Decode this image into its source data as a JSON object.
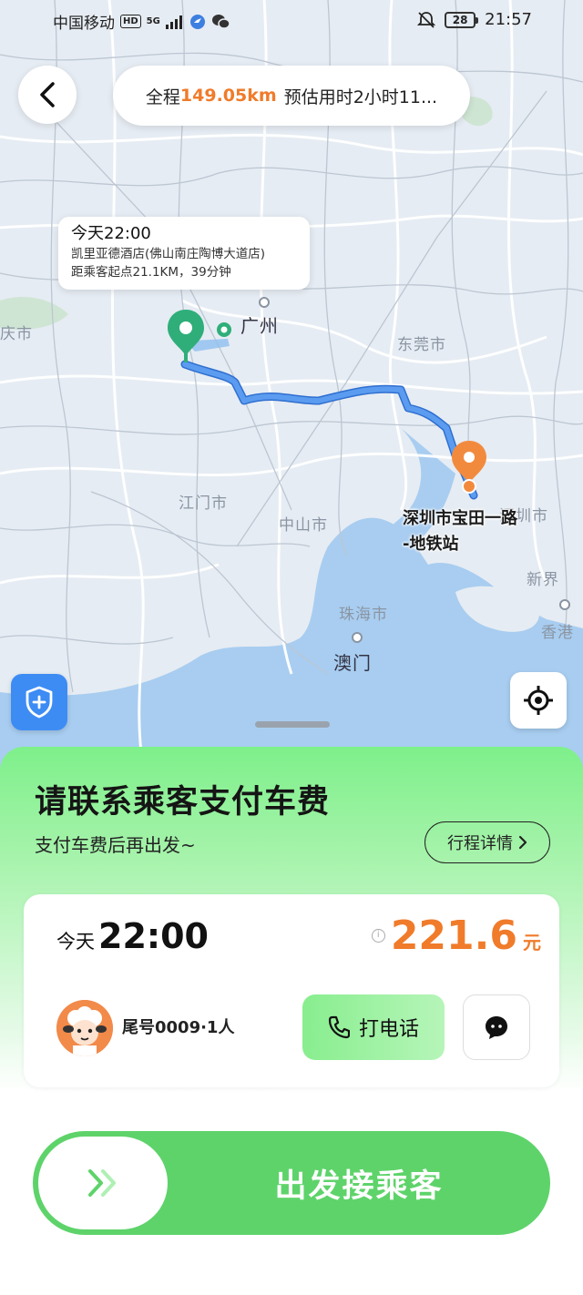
{
  "status_bar": {
    "carrier": "中国移动",
    "hd_badge": "HD",
    "network": "5G",
    "battery": "28",
    "time": "21:57"
  },
  "route": {
    "prefix": "全程",
    "distance": "149.05km",
    "estimate": "预估用时2小时11..."
  },
  "pickup": {
    "time": "今天22:00",
    "place": "凯里亚德酒店(佛山南庄陶博大道店)",
    "distance_info": "距乘客起点21.1KM，39分钟"
  },
  "destination": {
    "line1": "深圳市宝田一路",
    "line2": "-地铁站"
  },
  "map_labels": {
    "guangzhou": "广州",
    "dongguan": "东莞市",
    "jiangmen": "江门市",
    "zhongshan": "中山市",
    "zhuhai": "珠海市",
    "macau": "澳门",
    "shenzhen": "深圳市",
    "xinjie": "新界",
    "hongkong": "香港",
    "west_edge": "庆市"
  },
  "sheet": {
    "title": "请联系乘客支付车费",
    "subtitle": "支付车费后再出发~",
    "detail_button": "行程详情"
  },
  "order": {
    "day": "今天",
    "time": "22:00",
    "price": "221.6",
    "unit": "元",
    "passenger": "尾号0009·1人",
    "call_label": "打电话"
  },
  "depart_label": "出发接乘客",
  "colors": {
    "accent_orange": "#f07b2a",
    "route_blue": "#4a8de6",
    "pickup_green": "#2fae7a",
    "sheet_green": "#7ef08a",
    "slider_green": "#5ed36a",
    "shield_blue": "#3d8cf4"
  },
  "icons": {
    "back": "chevron-left-icon",
    "shield": "shield-plus-icon",
    "locate": "crosshair-icon",
    "detail": "chevron-right-icon",
    "call": "phone-icon",
    "message": "chat-bubble-icon",
    "slide": "double-chevron-right-icon"
  }
}
